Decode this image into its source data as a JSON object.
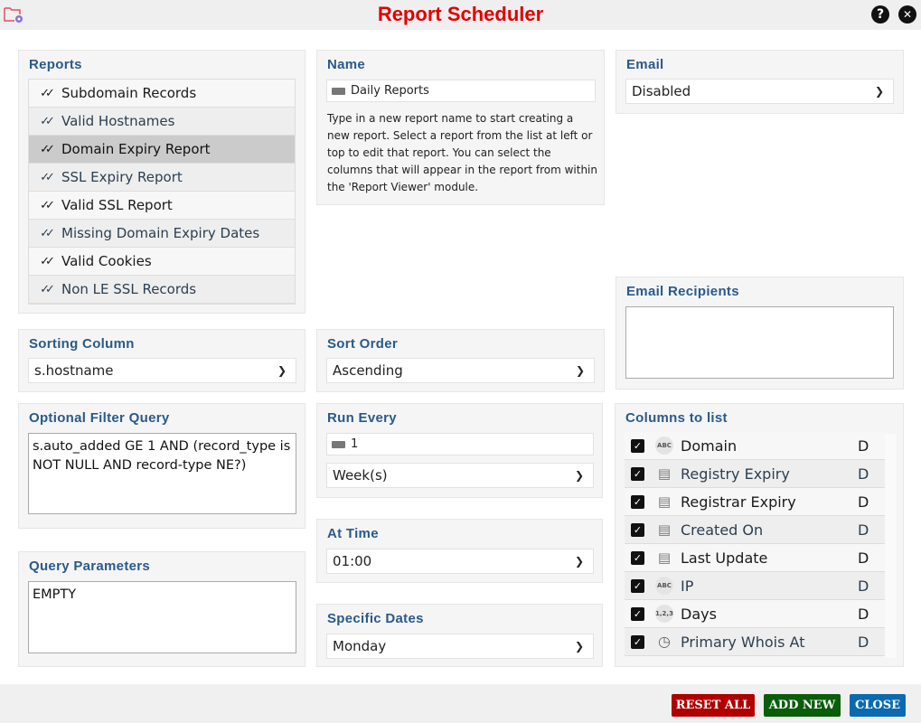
{
  "window": {
    "title": "Report Scheduler",
    "help_label": "?",
    "close_label": "✕"
  },
  "reports": {
    "heading": "Reports",
    "items": [
      "Subdomain Records",
      "Valid Hostnames",
      "Domain Expiry Report",
      "SSL Expiry Report",
      "Valid SSL Report",
      "Missing Domain Expiry Dates",
      "Valid Cookies",
      "Non LE SSL Records"
    ],
    "selected": "Domain Expiry Report"
  },
  "name": {
    "heading": "Name",
    "value": "Daily Reports",
    "help": "Type in a new report name to start creating a new report. Select a report from the list at left or top to edit that report. You can select the columns that will appear in the report from within the 'Report Viewer' module."
  },
  "email": {
    "heading": "Email",
    "value": "Disabled"
  },
  "email_recipients": {
    "heading": "Email Recipients",
    "value": ""
  },
  "sorting_column": {
    "heading": "Sorting Column",
    "value": "s.hostname"
  },
  "sort_order": {
    "heading": "Sort Order",
    "value": "Ascending"
  },
  "filter": {
    "heading": "Optional Filter Query",
    "value": "s.auto_added GE 1 AND (record_type is NOT NULL AND record-type NE?)"
  },
  "run_every": {
    "heading": "Run Every",
    "value": "1",
    "unit": "Week(s)"
  },
  "at_time": {
    "heading": "At Time",
    "value": "01:00"
  },
  "query_params": {
    "heading": "Query Parameters",
    "value": "EMPTY"
  },
  "specific_dates": {
    "heading": "Specific Dates",
    "value": "Monday"
  },
  "columns": {
    "heading": "Columns to list",
    "items": [
      {
        "name": "Domain",
        "icon": "abc-icon",
        "icon_text": "ABC",
        "type": "D",
        "checked": true
      },
      {
        "name": "Registry Expiry",
        "icon": "calendar-icon",
        "type": "D",
        "checked": true
      },
      {
        "name": "Registrar Expiry",
        "icon": "calendar-icon",
        "type": "D",
        "checked": true
      },
      {
        "name": "Created On",
        "icon": "calendar-icon",
        "type": "D",
        "checked": true
      },
      {
        "name": "Last Update",
        "icon": "calendar-icon",
        "type": "D",
        "checked": true
      },
      {
        "name": "IP",
        "icon": "abc-icon",
        "icon_text": "ABC",
        "type": "D",
        "checked": true
      },
      {
        "name": "Days",
        "icon": "number-icon",
        "icon_text": "1,2,3",
        "type": "D",
        "checked": true
      },
      {
        "name": "Primary Whois At",
        "icon": "clock-icon",
        "type": "D",
        "checked": true
      }
    ]
  },
  "footer": {
    "reset_label": "RESET ALL",
    "add_label": "ADD NEW",
    "close_label": "CLOSE"
  },
  "colors": {
    "title": "#e00000",
    "reset": "#b00000",
    "add": "#0a5e0a",
    "close": "#0a6ab0",
    "heading": "#2a5a8a"
  }
}
